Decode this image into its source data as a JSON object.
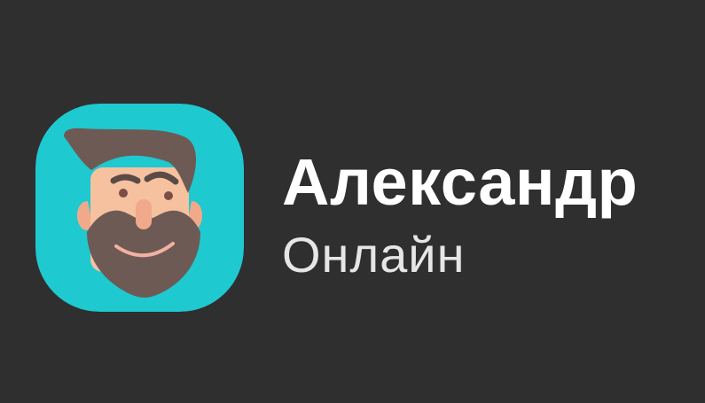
{
  "contact": {
    "name": "Александр",
    "status": "Онлайн",
    "avatar_icon": "bearded-man-avatar-icon"
  },
  "colors": {
    "background": "#2f2f2f",
    "avatar_bg": "#1ec9cf",
    "skin": "#f6c19f",
    "ear": "#f0a98a",
    "hair": "#6d5a55",
    "name_text": "#ffffff",
    "status_text": "#e6e6e6"
  }
}
